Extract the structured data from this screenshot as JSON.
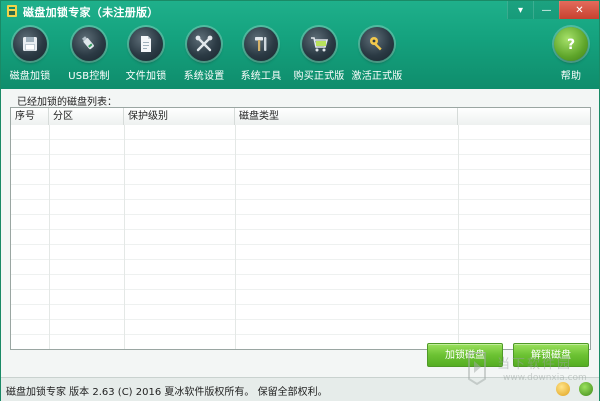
{
  "window": {
    "title": "磁盘加锁专家（未注册版）",
    "controls": {
      "menu": "▾",
      "minimize": "—",
      "close": "✕"
    }
  },
  "toolbar": {
    "items": [
      {
        "label": "磁盘加锁",
        "icon": "floppy-disk-icon"
      },
      {
        "label": "USB控制",
        "icon": "usb-drive-icon"
      },
      {
        "label": "文件加锁",
        "icon": "document-lock-icon"
      },
      {
        "label": "系统设置",
        "icon": "tools-icon"
      },
      {
        "label": "系统工具",
        "icon": "hammer-wrench-icon"
      },
      {
        "label": "购买正式版",
        "icon": "shopping-cart-icon"
      },
      {
        "label": "激活正式版",
        "icon": "key-icon"
      },
      {
        "label": "帮助",
        "icon": "help-icon"
      }
    ]
  },
  "list": {
    "caption": "已经加锁的磁盘列表：",
    "columns": [
      "序号",
      "分区",
      "保护级别",
      "磁盘类型",
      ""
    ],
    "rows": []
  },
  "buttons": {
    "lock": "加锁磁盘",
    "unlock": "解锁磁盘"
  },
  "status": {
    "text": "磁盘加锁专家 版本 2.63 (C) 2016 夏冰软件版权所有。 保留全部权利。"
  },
  "watermark": {
    "brand": "当下软件园",
    "url": "www.downxia.com"
  },
  "colors": {
    "header": "#15a37f",
    "button": "#6cc233",
    "accent": "#1a8a66"
  }
}
